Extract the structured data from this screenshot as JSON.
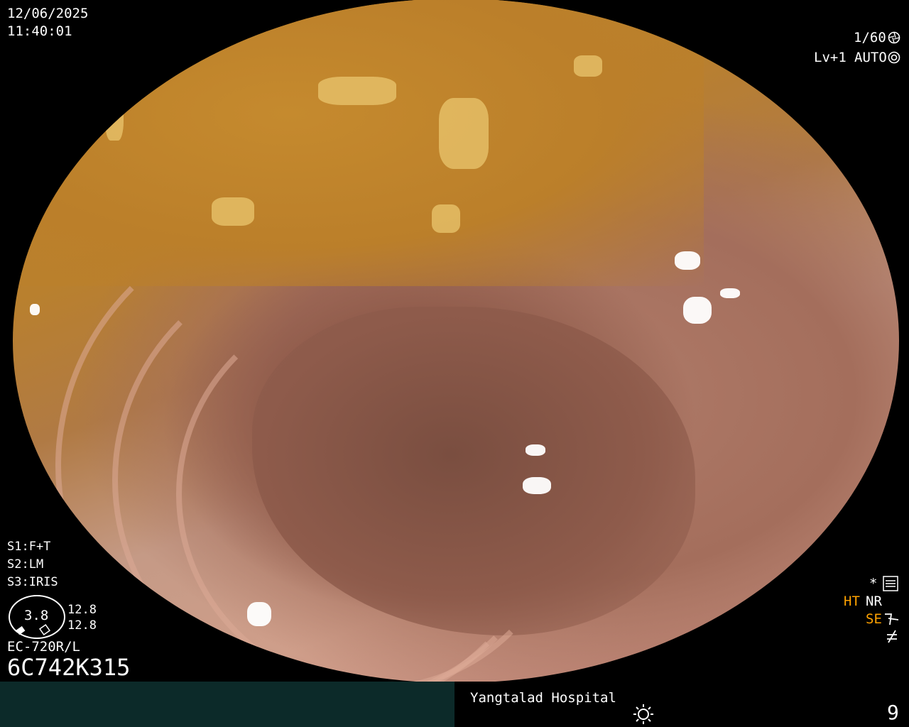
{
  "datetime": {
    "date": "12/06/2025",
    "time": "11:40:01"
  },
  "exposure": {
    "shutter": "1/60",
    "level": "Lv+1",
    "mode": "AUTO"
  },
  "settings": {
    "s1": "S1:F+T",
    "s2": "S2:LM",
    "s3": "S3:IRIS"
  },
  "gauge": {
    "value": "3.8",
    "reading_1": "12.8",
    "reading_2": "12.8"
  },
  "scope": {
    "model": "EC-720R/L",
    "serial": "6C742K315"
  },
  "indicators": {
    "star": "*",
    "ht": "HT",
    "nr": "NR",
    "se": "SE"
  },
  "footer": {
    "hospital": "Yangtalad Hospital",
    "page_number": "9"
  },
  "icons": {
    "shutter": "shutter-icon",
    "auto": "auto-iris-icon",
    "menu": "menu-list-icon",
    "se_link": "se-link-icon",
    "not_equal": "not-equal-icon",
    "brightness": "sun-icon"
  },
  "colors": {
    "accent_orange": "#ffa200",
    "footer_bar": "#0c2a29"
  }
}
